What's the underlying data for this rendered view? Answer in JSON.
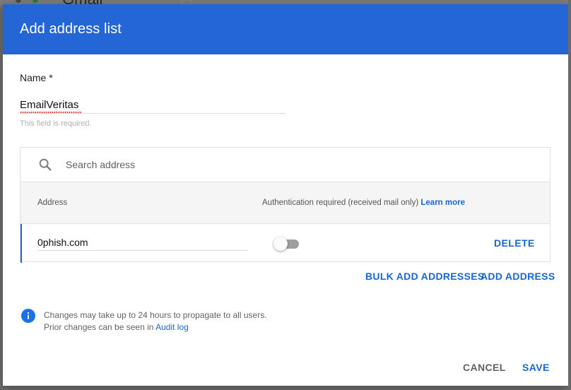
{
  "dialog": {
    "title": "Add address list",
    "name_label": "Name *",
    "name_value": "EmailVeritas",
    "name_hint": "This field is required."
  },
  "table": {
    "search_placeholder": "Search address",
    "headers": {
      "address": "Address",
      "auth": "Authentication required (received mail only)",
      "learn_more": "Learn more"
    },
    "rows": [
      {
        "address": "0phish.com",
        "auth_required": false,
        "delete_label": "DELETE"
      }
    ]
  },
  "actions": {
    "bulk_add": "BULK ADD ADDRESSES",
    "add": "ADD ADDRESS"
  },
  "info": {
    "line1": "Changes may take up to 24 hours to propagate to all users.",
    "line2_prefix": "Prior changes can be seen in",
    "audit_link": "Audit log"
  },
  "footer": {
    "cancel": "CANCEL",
    "save": "SAVE"
  },
  "background": {
    "partial_title": "Gmail"
  },
  "colors": {
    "header": "#2566d6",
    "link": "#1a66d2",
    "info_icon": "#1a73e8"
  },
  "icons": {
    "search": "search-icon",
    "info": "info-icon"
  }
}
